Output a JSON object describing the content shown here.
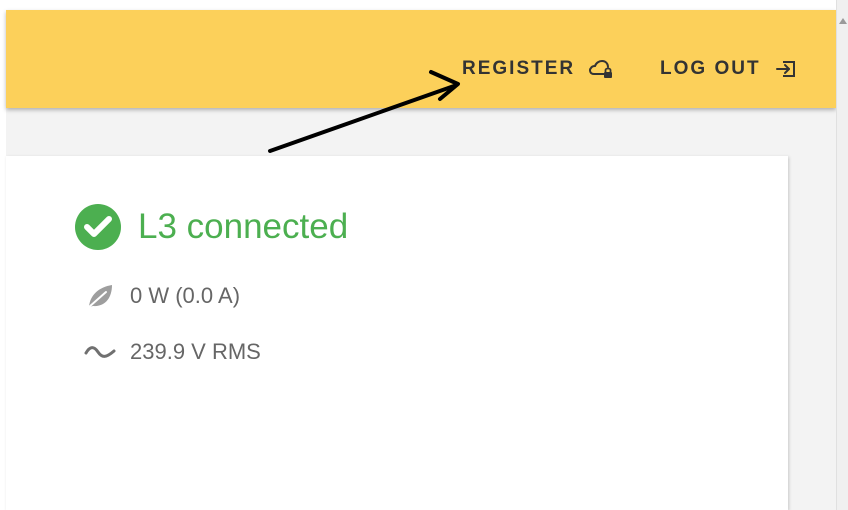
{
  "app_bar": {
    "background": "#fcd05a",
    "register_label": "REGISTER",
    "register_icon": "cloud-lock-icon",
    "logout_label": "LOG OUT",
    "logout_icon": "logout-icon"
  },
  "status": {
    "text": "L3 connected",
    "color": "#4caf50",
    "icon": "check-circle-icon"
  },
  "metrics": {
    "power": {
      "text": "0 W (0.0 A)",
      "icon": "leaf-icon"
    },
    "voltage": {
      "text": "239.9 V RMS",
      "icon": "sine-wave-icon"
    }
  },
  "annotation": {
    "icon": "arrow-annotation",
    "color": "#000000"
  }
}
